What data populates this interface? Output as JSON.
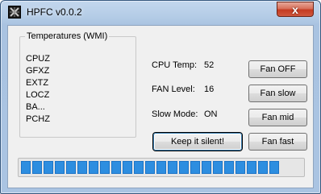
{
  "window": {
    "title": "HPFC v0.0.2",
    "close_glyph": "x",
    "icon": "app-icon"
  },
  "temperatures": {
    "group_title": "Temperatures (WMI)",
    "items": [
      "CPUZ",
      "GFXZ",
      "EXTZ",
      "LOCZ",
      "BA...",
      "PCHZ"
    ]
  },
  "status": {
    "cpu_temp_label": "CPU Temp:",
    "cpu_temp_value": "52",
    "fan_level_label": "FAN Level:",
    "fan_level_value": "16",
    "slow_mode_label": "Slow Mode:",
    "slow_mode_value": "ON"
  },
  "buttons": {
    "fan_off": "Fan OFF",
    "fan_slow": "Fan slow",
    "fan_mid": "Fan mid",
    "fan_fast": "Fan fast",
    "keep_silent": "Keep it silent!"
  },
  "progress": {
    "fraction": 0.95,
    "color": "#2d8ee0"
  }
}
